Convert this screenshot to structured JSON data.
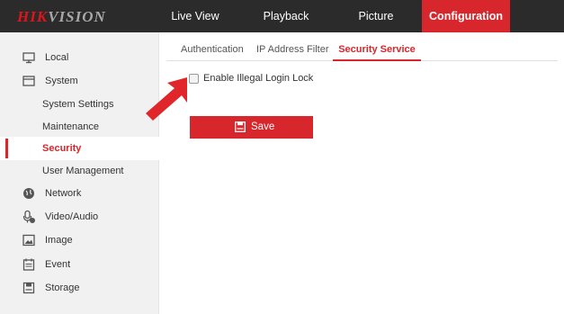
{
  "brand": {
    "logo_red": "HIK",
    "logo_grey": "VISION"
  },
  "colors": {
    "accent": "#d7262c",
    "topbar": "#2b2b2b",
    "sidebar": "#f1f1f1"
  },
  "nav": {
    "live_view": "Live View",
    "playback": "Playback",
    "picture": "Picture",
    "configuration": "Configuration",
    "active": "Configuration"
  },
  "sidebar": {
    "items": [
      {
        "label": "Local",
        "icon": "monitor-icon"
      },
      {
        "label": "System",
        "icon": "system-icon"
      },
      {
        "label": "System Settings",
        "sub": true
      },
      {
        "label": "Maintenance",
        "sub": true
      },
      {
        "label": "Security",
        "sub": true,
        "active": true
      },
      {
        "label": "User Management",
        "sub": true
      },
      {
        "label": "Network",
        "icon": "globe-icon"
      },
      {
        "label": "Video/Audio",
        "icon": "microphone-icon"
      },
      {
        "label": "Image",
        "icon": "image-icon"
      },
      {
        "label": "Event",
        "icon": "calendar-icon"
      },
      {
        "label": "Storage",
        "icon": "storage-icon"
      }
    ]
  },
  "tabs": {
    "authentication": "Authentication",
    "ip_filter": "IP Address Filter",
    "security_service": "Security Service",
    "active": "Security Service"
  },
  "form": {
    "illegal_login_lock_label": "Enable Illegal Login Lock",
    "illegal_login_lock_checked": false
  },
  "actions": {
    "save_label": "Save",
    "save_icon": "floppy-disk-icon"
  },
  "annotation": {
    "arrow_icon": "red-pointer-arrow"
  }
}
